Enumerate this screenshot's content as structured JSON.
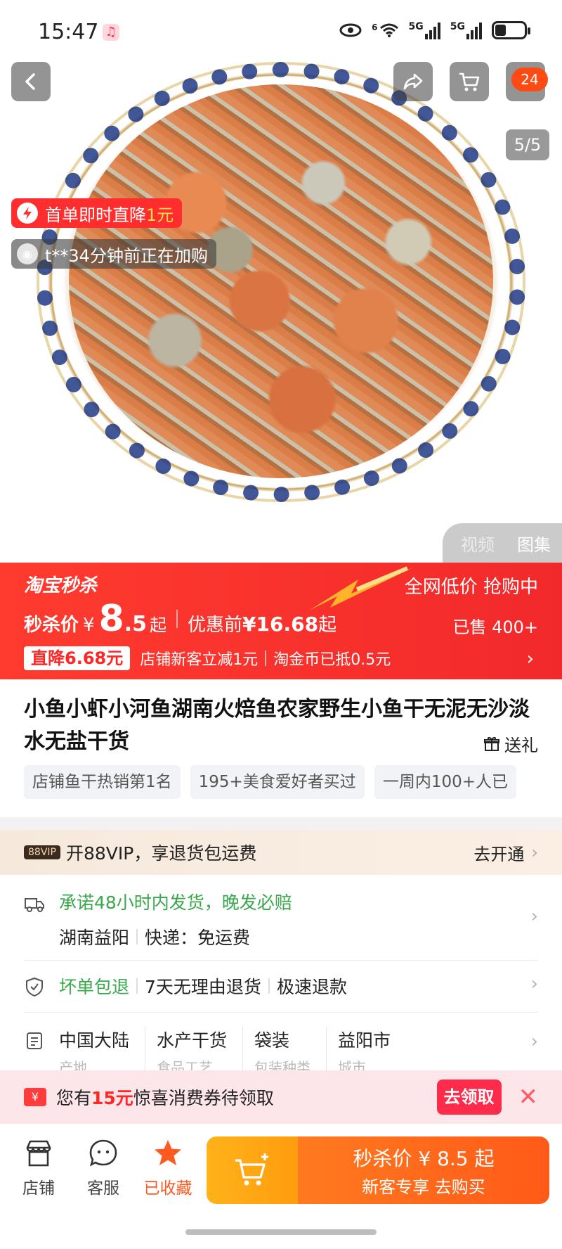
{
  "status_bar": {
    "time": "15:47",
    "signal_1": "5G",
    "signal_2": "5G",
    "wifi_sup": "6"
  },
  "nav": {
    "cart_badge": "24",
    "page_indicator": "5/5"
  },
  "image_tags": {
    "promo_prefix": "首单即时直降",
    "promo_amount": "1元",
    "activity": "t**34分钟前正在加购"
  },
  "media_tabs": [
    "视频",
    "图集"
  ],
  "banner": {
    "brand": "淘宝秒杀",
    "right_text": "全网低价 抢购中",
    "price_label": "秒杀价",
    "currency": "¥",
    "price_int": "8",
    "price_dec": ".5",
    "price_suffix": "起",
    "orig_label": "优惠前",
    "orig_price": "¥16.68",
    "orig_suffix": "起",
    "sold": "已售 400+",
    "drop_tag": "直降6.68元",
    "coupon_1": "店铺新客立减1元",
    "coupon_2": "淘金币已抵0.5元",
    "colors": {
      "banner_red": "#ff3b2f",
      "accent_orange": "#ff5a18"
    }
  },
  "product": {
    "title": "小鱼小虾小河鱼湖南火焙鱼农家野生小鱼干无泥无沙淡水无盐干货",
    "gift": "送礼",
    "chips": [
      "店铺鱼干热销第1名",
      "195+美食爱好者买过",
      "一周内100+人已"
    ]
  },
  "vip": {
    "badge": "88VIP",
    "text": "开88VIP，享退货包运费",
    "cta": "去开通"
  },
  "services": {
    "ship_promise": "承诺48小时内发货，晚发必赔",
    "origin": "湖南益阳",
    "shipping": "快递：免运费",
    "guarantee": "坏单包退",
    "return_policy": "7天无理由退货",
    "refund": "极速退款",
    "params": [
      {
        "value": "中国大陆",
        "label": "产地"
      },
      {
        "value": "水产干货",
        "label": "食品工艺"
      },
      {
        "value": "袋装",
        "label": "包装种类"
      },
      {
        "value": "益阳市",
        "label": "城市"
      }
    ]
  },
  "coupon_strip": {
    "icon": "¥",
    "prefix": "您有",
    "amount": "15元",
    "suffix": "惊喜消费券待领取",
    "button": "去领取"
  },
  "bottom": {
    "store": "店铺",
    "service": "客服",
    "favorited": "已收藏",
    "buy_line1": "秒杀价 ¥ 8.5 起",
    "buy_line2": "新客专享 去购买"
  }
}
